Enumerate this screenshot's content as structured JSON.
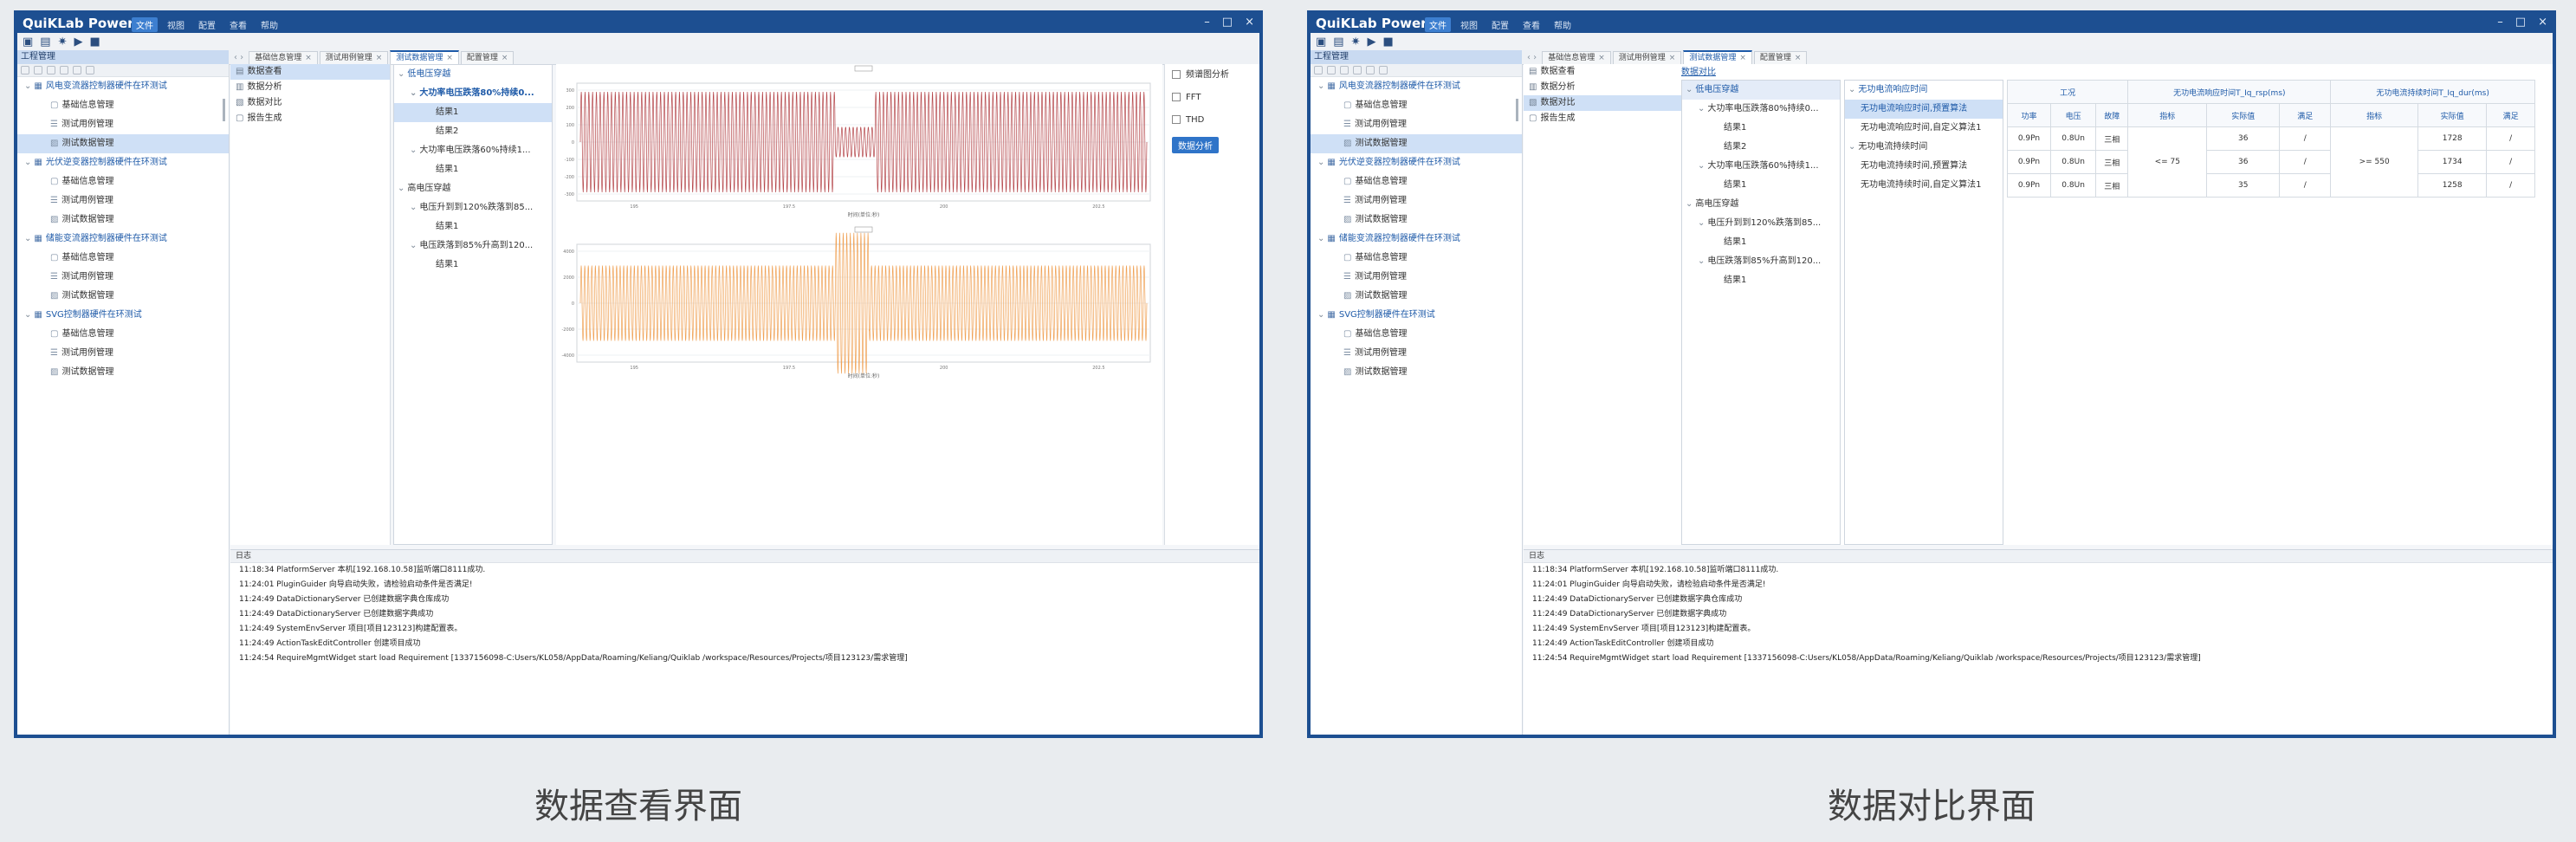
{
  "app": {
    "title": "QuiKLab Power",
    "menu": [
      "文件",
      "视图",
      "配置",
      "查看",
      "帮助"
    ],
    "window_controls": [
      "–",
      "□",
      "×"
    ]
  },
  "colors": {
    "accent": "#1d4f91",
    "selected": "#cfe0f6",
    "red_wave": "#b5474b",
    "orange_wave": "#f0a256"
  },
  "project_panel": {
    "header": "工程管理",
    "groups": [
      {
        "label": "风电变流器控制器硬件在环测试",
        "items": [
          "基础信息管理",
          "测试用例管理",
          "测试数据管理"
        ]
      },
      {
        "label": "光伏逆变器控制器硬件在环测试",
        "items": [
          "基础信息管理",
          "测试用例管理",
          "测试数据管理"
        ]
      },
      {
        "label": "储能变流器控制器硬件在环测试",
        "items": [
          "基础信息管理",
          "测试用例管理",
          "测试数据管理"
        ]
      },
      {
        "label": "SVG控制器硬件在环测试",
        "items": [
          "基础信息管理",
          "测试用例管理",
          "测试数据管理"
        ]
      }
    ]
  },
  "tabs": [
    "基础信息管理",
    "测试用例管理",
    "测试数据管理",
    "配置管理"
  ],
  "functions": [
    "数据查看",
    "数据分析",
    "数据对比",
    "报告生成"
  ],
  "case_tree": {
    "root": "低电压穿越",
    "case1": "大功率电压跌落80%持续0...",
    "case2": "大功率电压跌落60%持续1...",
    "results": [
      "结果1",
      "结果2"
    ],
    "root2": "高电压穿越",
    "case3": "电压升到到120%跌落到85...",
    "case4": "电压跌落到85%升高到120..."
  },
  "compare_tree": {
    "header": "数据对比",
    "root1": "无功电流响应时间",
    "item1": "无功电流响应时间,预置算法",
    "item2": "无功电流响应时间,自定义算法1",
    "root2": "无功电流持续时间",
    "item3": "无功电流持续时间,预置算法",
    "item4": "无功电流持续时间,自定义算法1"
  },
  "options": {
    "frequency": "频谱图分析",
    "fft": "FFT",
    "thd": "THD",
    "button": "数据分析"
  },
  "results_table": {
    "group_header": "工况",
    "col1_header": "无功电流响应时间T_Iq_rsp(ms)",
    "col2_header": "无功电流持续时间T_Iq_dur(ms)",
    "subheaders": [
      "功率",
      "电压",
      "故障",
      "指标",
      "实际值",
      "满足",
      "指标",
      "实际值",
      "满足"
    ],
    "rows": [
      {
        "power": "0.9Pn",
        "voltage": "0.8Un",
        "fault": "三相",
        "act1": "36",
        "ok1": "/",
        "act2": "1728",
        "ok2": "/"
      },
      {
        "power": "0.9Pn",
        "voltage": "0.8Un",
        "fault": "三相",
        "act1": "36",
        "ok1": "/",
        "act2": "1734",
        "ok2": "/"
      },
      {
        "power": "0.9Pn",
        "voltage": "0.8Un",
        "fault": "三相",
        "act1": "35",
        "ok1": "/",
        "act2": "1258",
        "ok2": "/"
      }
    ],
    "spec1": "<= 75",
    "spec2": ">= 550"
  },
  "log": {
    "header": "日志",
    "lines": [
      "11:18:34 PlatformServer 本机[192.168.10.58]监听端口8111成功.",
      "11:24:01 PluginGuider 向导启动失败，请检验启动条件是否满足!",
      "11:24:49 DataDictionaryServer 已创建数据字典仓库成功",
      "11:24:49 DataDictionaryServer 已创建数据字典成功",
      "11:24:49 SystemEnvServer 项目[项目123123]构建配置表。",
      "11:24:49 ActionTaskEditController 创建项目成功",
      "11:24:54 RequireMgmtWidget start load Requirement [1337156098-C:Users/KL058/AppData/Roaming/Keliang/Quiklab /workspace/Resources/Projects/项目123123/需求管理]"
    ]
  },
  "chart_data": [
    {
      "type": "line",
      "title": "",
      "xlabel": "时间(单位:秒)",
      "ylabel": "",
      "xticks": [
        "195",
        "197.5",
        "200",
        "202.5"
      ],
      "yticks": [
        "300",
        "200",
        "100",
        "0",
        "-100",
        "-200",
        "-300"
      ],
      "series": [
        {
          "color": "#b5474b"
        }
      ]
    },
    {
      "type": "line",
      "title": "",
      "xlabel": "时间(单位:秒)",
      "ylabel": "",
      "xticks": [
        "195",
        "197.5",
        "200",
        "202.5"
      ],
      "yticks": [
        "4000",
        "2000",
        "0",
        "-2000",
        "-4000"
      ],
      "series": [
        {
          "color": "#f0a256"
        }
      ]
    }
  ],
  "captions": {
    "left": "数据查看界面",
    "right": "数据对比界面"
  }
}
